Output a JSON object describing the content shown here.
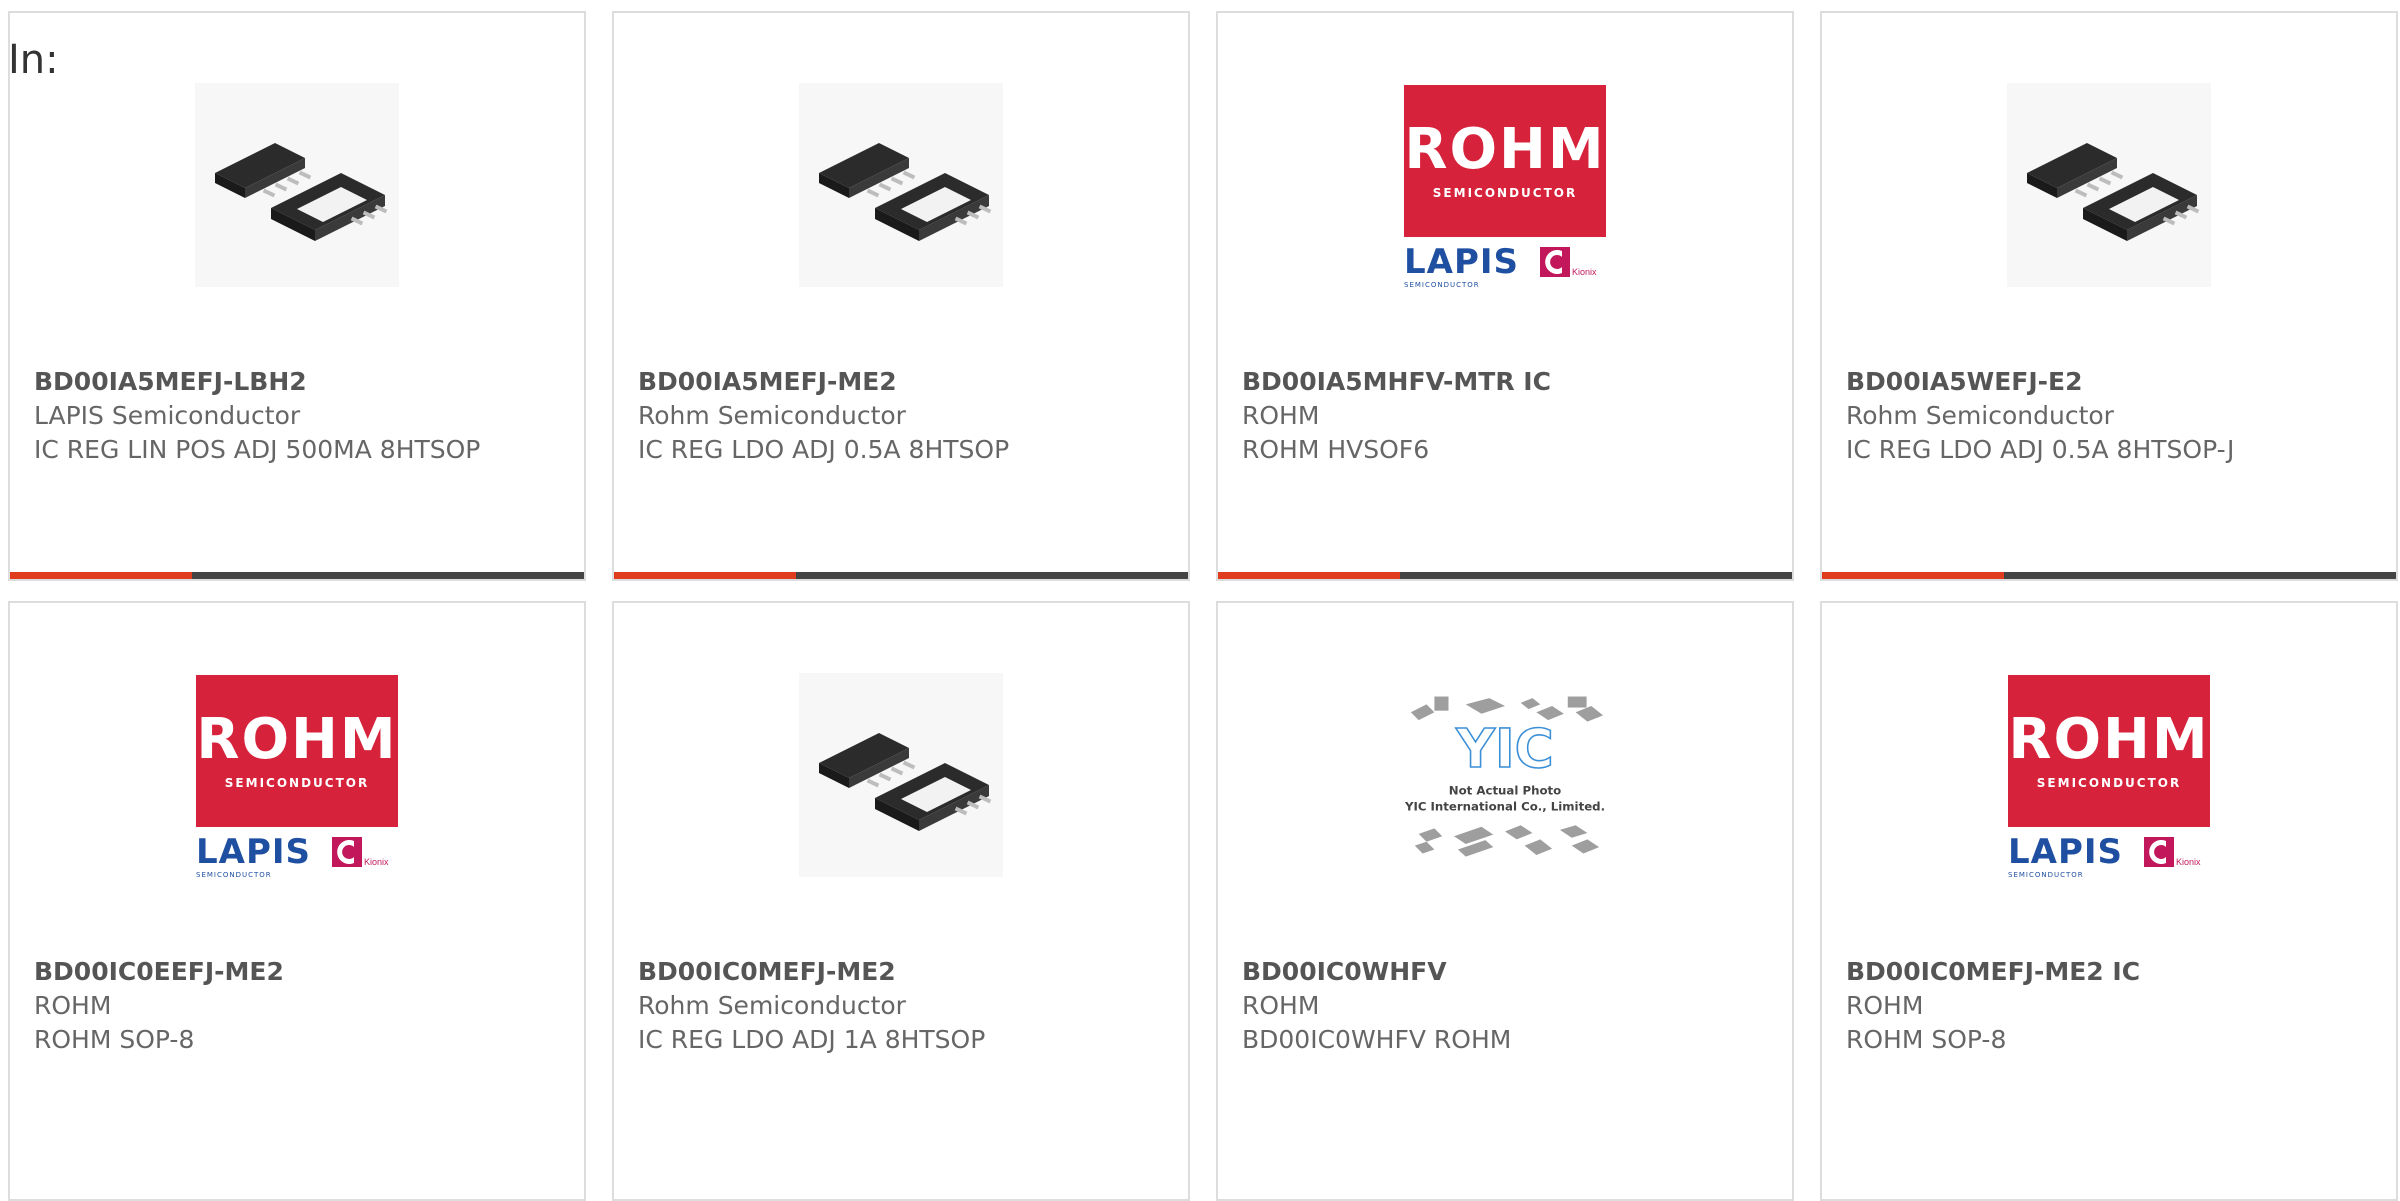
{
  "page": {
    "in_label": "In:"
  },
  "colors": {
    "accent": "#e03c1e",
    "bar": "#444444",
    "rohm_red": "#d7223b",
    "lapis_blue": "#1f4fa0",
    "kionix_magenta": "#c2185b"
  },
  "products": [
    {
      "part": "BD00IA5MEFJ-LBH2",
      "manufacturer": "LAPIS Semiconductor",
      "description": "IC REG LIN POS ADJ 500MA 8HTSOP",
      "image": "htsop-chip-icon"
    },
    {
      "part": "BD00IA5MEFJ-ME2",
      "manufacturer": "Rohm Semiconductor",
      "description": "IC REG LDO ADJ 0.5A 8HTSOP",
      "image": "htsop-chip-icon"
    },
    {
      "part": "BD00IA5MHFV-MTR IC",
      "manufacturer": "ROHM",
      "description": "ROHM HVSOF6",
      "image": "rohm-logo"
    },
    {
      "part": "BD00IA5WEFJ-E2",
      "manufacturer": "Rohm Semiconductor",
      "description": "IC REG LDO ADJ 0.5A 8HTSOP-J",
      "image": "htsop-chip-icon"
    },
    {
      "part": "BD00IC0EEFJ-ME2",
      "manufacturer": "ROHM",
      "description": "ROHM SOP-8",
      "image": "rohm-logo"
    },
    {
      "part": "BD00IC0MEFJ-ME2",
      "manufacturer": "Rohm Semiconductor",
      "description": "IC REG LDO ADJ 1A 8HTSOP",
      "image": "htsop-chip-icon"
    },
    {
      "part": "BD00IC0WHFV",
      "manufacturer": "ROHM",
      "description": "BD00IC0WHFV ROHM",
      "image": "yic-placeholder"
    },
    {
      "part": "BD00IC0MEFJ-ME2 IC",
      "manufacturer": "ROHM",
      "description": "ROHM SOP-8",
      "image": "rohm-logo"
    }
  ],
  "logos": {
    "rohm": "ROHM",
    "rohm_sub": "SEMICONDUCTOR",
    "lapis": "LAPIS",
    "lapis_sub": "SEMICONDUCTOR",
    "kionix": "Kionix",
    "yic_mark": "YIC",
    "yic_line1": "Not Actual Photo",
    "yic_line2": "YIC International Co., Limited."
  }
}
